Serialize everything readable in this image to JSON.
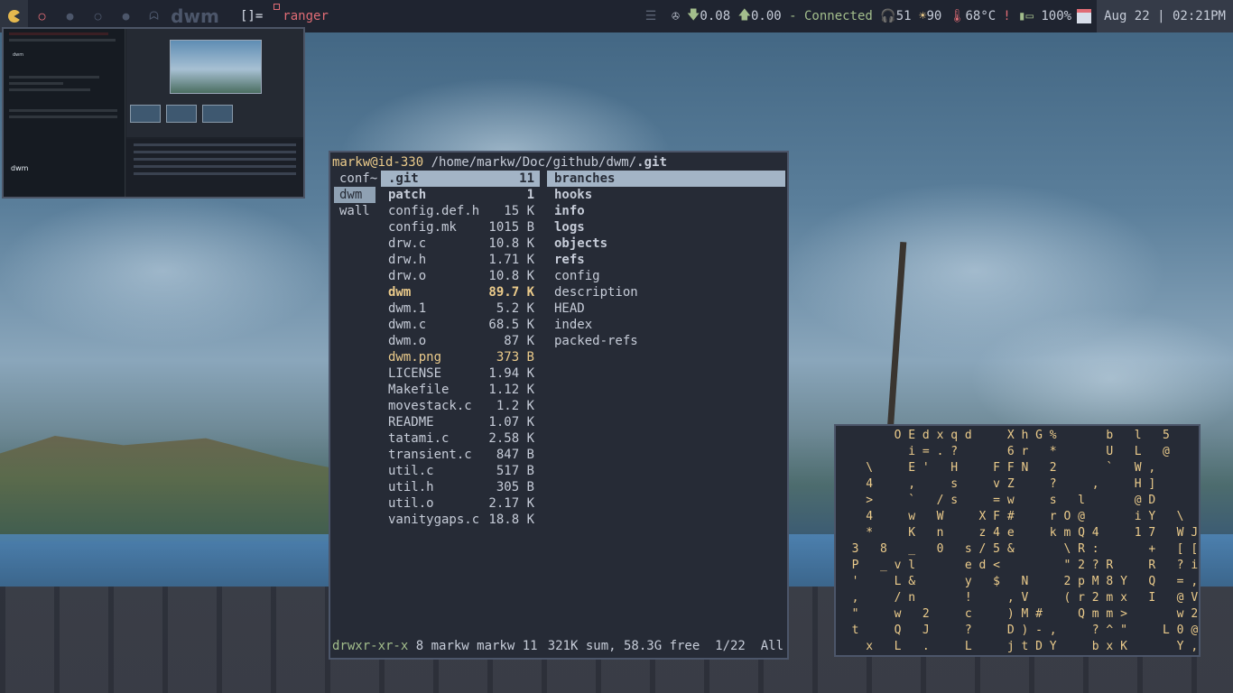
{
  "bar": {
    "tags": [
      "pacman-icon",
      "circle-icon",
      "dot-icon",
      "ring-icon",
      "dot-icon",
      "ghost-icon"
    ],
    "wm_logo": "dwm",
    "layout": "[]=",
    "window_title": "ranger",
    "net_down": "0.08",
    "net_up": "0.00",
    "net_sep": " - ",
    "net_status": "Connected",
    "volume": "51",
    "brightness": "90",
    "temperature": "68°C",
    "alert": "!",
    "battery": "100%",
    "date": "Aug 22",
    "sep": "|",
    "time": "02:21PM"
  },
  "preview": {
    "repo_owner": "dwm",
    "repo_name": "dwm"
  },
  "ranger": {
    "user_host": "markw@id-330",
    "path": " /home/markw/Doc/github/dwm/",
    "current": ".git",
    "parent_entries": [
      {
        "name": "conf~",
        "selected": false
      },
      {
        "name": "dwm",
        "selected": true
      },
      {
        "name": "wall",
        "selected": false
      }
    ],
    "files": [
      {
        "name": ".git",
        "size": "11",
        "type": "dir",
        "selected": true
      },
      {
        "name": "patch",
        "size": "1",
        "type": "dir"
      },
      {
        "name": "config.def.h",
        "size": "15 K",
        "type": "file"
      },
      {
        "name": "config.mk",
        "size": "1015 B",
        "type": "file"
      },
      {
        "name": "drw.c",
        "size": "10.8 K",
        "type": "file"
      },
      {
        "name": "drw.h",
        "size": "1.71 K",
        "type": "file"
      },
      {
        "name": "drw.o",
        "size": "10.8 K",
        "type": "file"
      },
      {
        "name": "dwm",
        "size": "89.7 K",
        "type": "exe"
      },
      {
        "name": "dwm.1",
        "size": "5.2 K",
        "type": "file"
      },
      {
        "name": "dwm.c",
        "size": "68.5 K",
        "type": "file"
      },
      {
        "name": "dwm.o",
        "size": "87 K",
        "type": "file"
      },
      {
        "name": "dwm.png",
        "size": "373 B",
        "type": "img"
      },
      {
        "name": "LICENSE",
        "size": "1.94 K",
        "type": "file"
      },
      {
        "name": "Makefile",
        "size": "1.12 K",
        "type": "file"
      },
      {
        "name": "movestack.c",
        "size": "1.2 K",
        "type": "file"
      },
      {
        "name": "README",
        "size": "1.07 K",
        "type": "file"
      },
      {
        "name": "tatami.c",
        "size": "2.58 K",
        "type": "file"
      },
      {
        "name": "transient.c",
        "size": "847 B",
        "type": "file"
      },
      {
        "name": "util.c",
        "size": "517 B",
        "type": "file"
      },
      {
        "name": "util.h",
        "size": "305 B",
        "type": "file"
      },
      {
        "name": "util.o",
        "size": "2.17 K",
        "type": "file"
      },
      {
        "name": "vanitygaps.c",
        "size": "18.8 K",
        "type": "file"
      }
    ],
    "preview_entries": [
      {
        "name": "branches",
        "type": "dir",
        "selected": true
      },
      {
        "name": "hooks",
        "type": "dir"
      },
      {
        "name": "info",
        "type": "dir"
      },
      {
        "name": "logs",
        "type": "dir"
      },
      {
        "name": "objects",
        "type": "dir"
      },
      {
        "name": "refs",
        "type": "dir"
      },
      {
        "name": "config",
        "type": "file"
      },
      {
        "name": "description",
        "type": "file"
      },
      {
        "name": "HEAD",
        "type": "file"
      },
      {
        "name": "index",
        "type": "file"
      },
      {
        "name": "packed-refs",
        "type": "file"
      }
    ],
    "footer": {
      "permissions": "drwxr-xr-x",
      "info": " 8 markw markw 11",
      "summary": "321K sum, 58.3G free  1/22  All"
    }
  },
  "matrix_text": "        O E d x q d     X h G %       b   l   5\n          i = . ?       6 r   *       U   L   @\n    \\     E '   H     F F N   2       `   W ,\n    4     ,     s     v Z     ?     ,     H ]\n    >     `   / s     = w     s   l       @ D\n    4     w   W     X F #     r O @       i Y   \\\n    *     K   n     z 4 e     k m Q 4     1 7   W J\n  3   8   _   0   s / 5 &       \\ R :       +   [ [\n  P   _ v l       e d <         \" 2 ? R     R   ? i\n  '     L &       y   $   N     2 p M 8 Y   Q   = ,\n  ,     / n       !     , V     ( r 2 m x   I   @ V\n  \"     w   2     c     ) M #     Q m m >       w 2\n  t     Q   J     ?     D ) - ,     ? ^ \"     L 0 @\n    x   L   .     L     j t D Y     b x K       Y , V"
}
